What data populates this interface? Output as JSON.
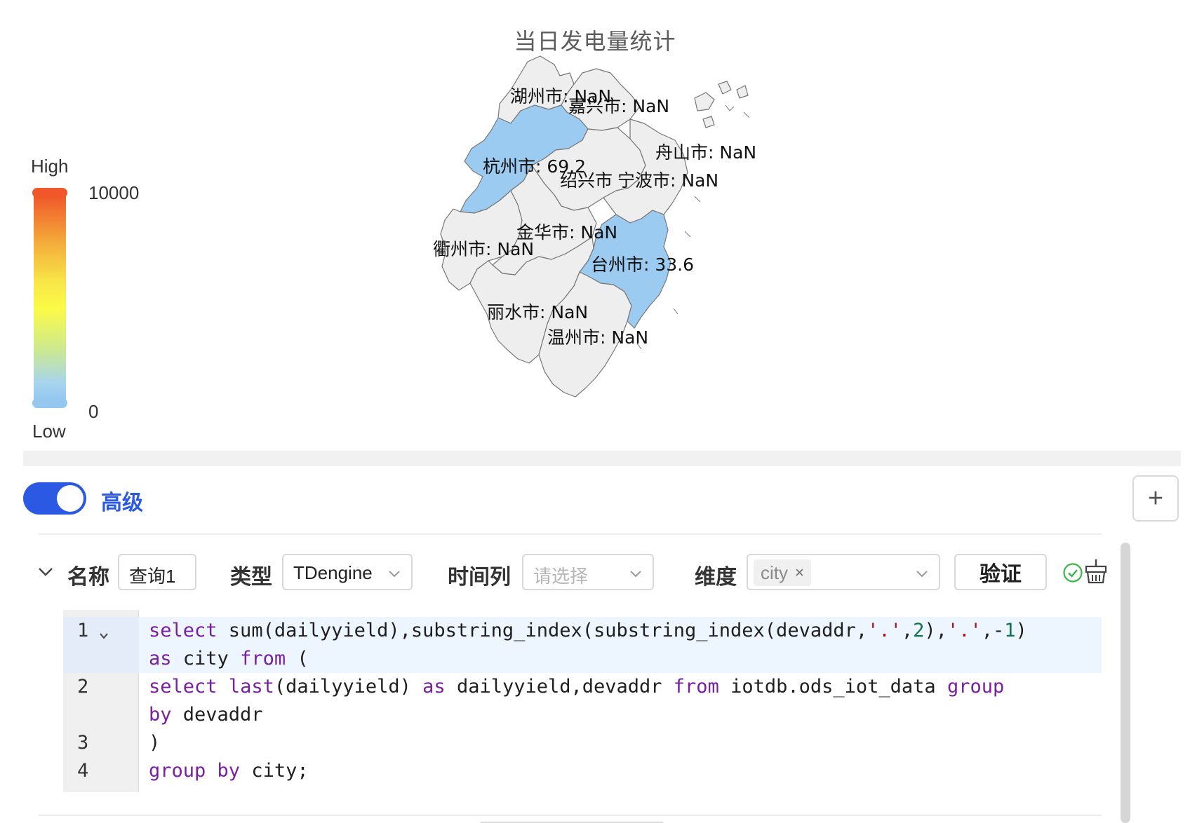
{
  "chart_data": {
    "type": "map",
    "title": "当日发电量统计",
    "visual_map": {
      "high_label": "High",
      "low_label": "Low",
      "max": "10000",
      "min": "0",
      "colors": [
        "#94c8f0",
        "#fbfb46",
        "#f0582a"
      ]
    },
    "regions": [
      {
        "name": "湖州市",
        "value": "NaN",
        "label": "湖州市: NaN"
      },
      {
        "name": "嘉兴市",
        "value": "NaN",
        "label": "嘉兴市: NaN"
      },
      {
        "name": "杭州市",
        "value": 69.2,
        "label": "杭州市: 69.2"
      },
      {
        "name": "舟山市",
        "value": "NaN",
        "label": "舟山市: NaN"
      },
      {
        "name": "绍兴市",
        "value": "NaN",
        "label": "绍兴市"
      },
      {
        "name": "宁波市",
        "value": "NaN",
        "label": "宁波市: NaN"
      },
      {
        "name": "金华市",
        "value": "NaN",
        "label": "金华市: NaN"
      },
      {
        "name": "衢州市",
        "value": "NaN",
        "label": "衢州市: NaN"
      },
      {
        "name": "台州市",
        "value": 33.6,
        "label": "台州市: 33.6"
      },
      {
        "name": "丽水市",
        "value": "NaN",
        "label": "丽水市: NaN"
      },
      {
        "name": "温州市",
        "value": "NaN",
        "label": "温州市: NaN"
      }
    ],
    "colors": {
      "empty": "#eeeeee",
      "has_value": "#9ccbf2",
      "border": "#777777"
    }
  },
  "mode_toggle": {
    "label": "高级",
    "on": true
  },
  "add_button": {
    "label": "+"
  },
  "query": {
    "name_label": "名称",
    "name_value": "查询1",
    "type_label": "类型",
    "type_value": "TDengine",
    "time_label": "时间列",
    "time_placeholder": "请选择",
    "dimension_label": "维度",
    "dimension_tag": "city",
    "dimension_tag_close": "×",
    "verify_label": "验证"
  },
  "code": {
    "line_numbers": [
      "1",
      "2",
      "3",
      "4"
    ],
    "lines": [
      "select sum(dailyyield),substring_index(substring_index(devaddr,'.',2),'.',-1)",
      "as city from (",
      "select last(dailyyield) as dailyyield,devaddr from iotdb.ods_iot_data group",
      "by devaddr",
      ")",
      "group by city;"
    ]
  }
}
